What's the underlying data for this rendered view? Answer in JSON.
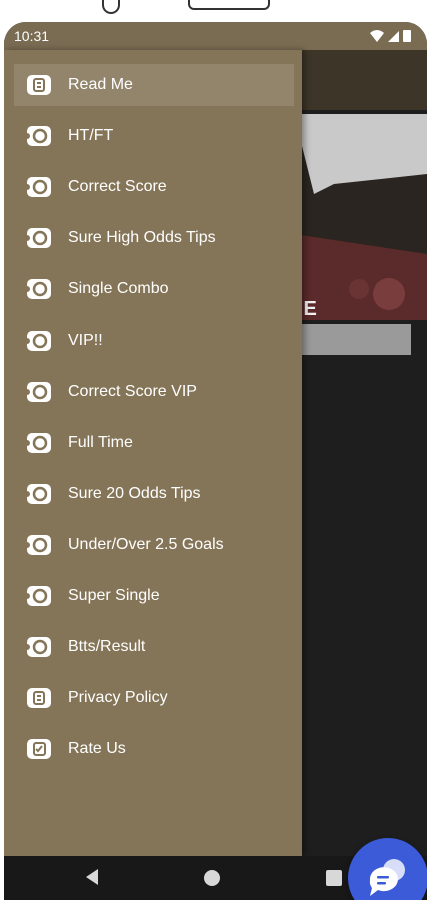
{
  "status_bar": {
    "time": "10:31"
  },
  "drawer": {
    "items": [
      {
        "label": "Read Me",
        "icon": "info-icon",
        "active": true
      },
      {
        "label": "HT/FT",
        "icon": "ticket-icon"
      },
      {
        "label": "Correct Score",
        "icon": "ticket-icon"
      },
      {
        "label": "Sure High Odds Tips",
        "icon": "ticket-icon"
      },
      {
        "label": "Single Combo",
        "icon": "ticket-icon"
      },
      {
        "label": "VIP!!",
        "icon": "ticket-icon"
      },
      {
        "label": "Correct Score VIP",
        "icon": "ticket-icon"
      },
      {
        "label": "Full Time",
        "icon": "ticket-icon"
      },
      {
        "label": "Sure 20 Odds Tips",
        "icon": "ticket-icon"
      },
      {
        "label": "Under/Over 2.5 Goals",
        "icon": "ticket-icon"
      },
      {
        "label": "Super Single",
        "icon": "ticket-icon"
      },
      {
        "label": "Btts/Result",
        "icon": "ticket-icon"
      },
      {
        "label": "Privacy Policy",
        "icon": "info-icon"
      },
      {
        "label": "Rate Us",
        "icon": "rate-icon"
      }
    ]
  },
  "background": {
    "banner_text": "RE"
  },
  "colors": {
    "drawer_bg": "#857558",
    "toolbar_bg": "#3d3628",
    "fab_bg": "#3c5bd9"
  }
}
